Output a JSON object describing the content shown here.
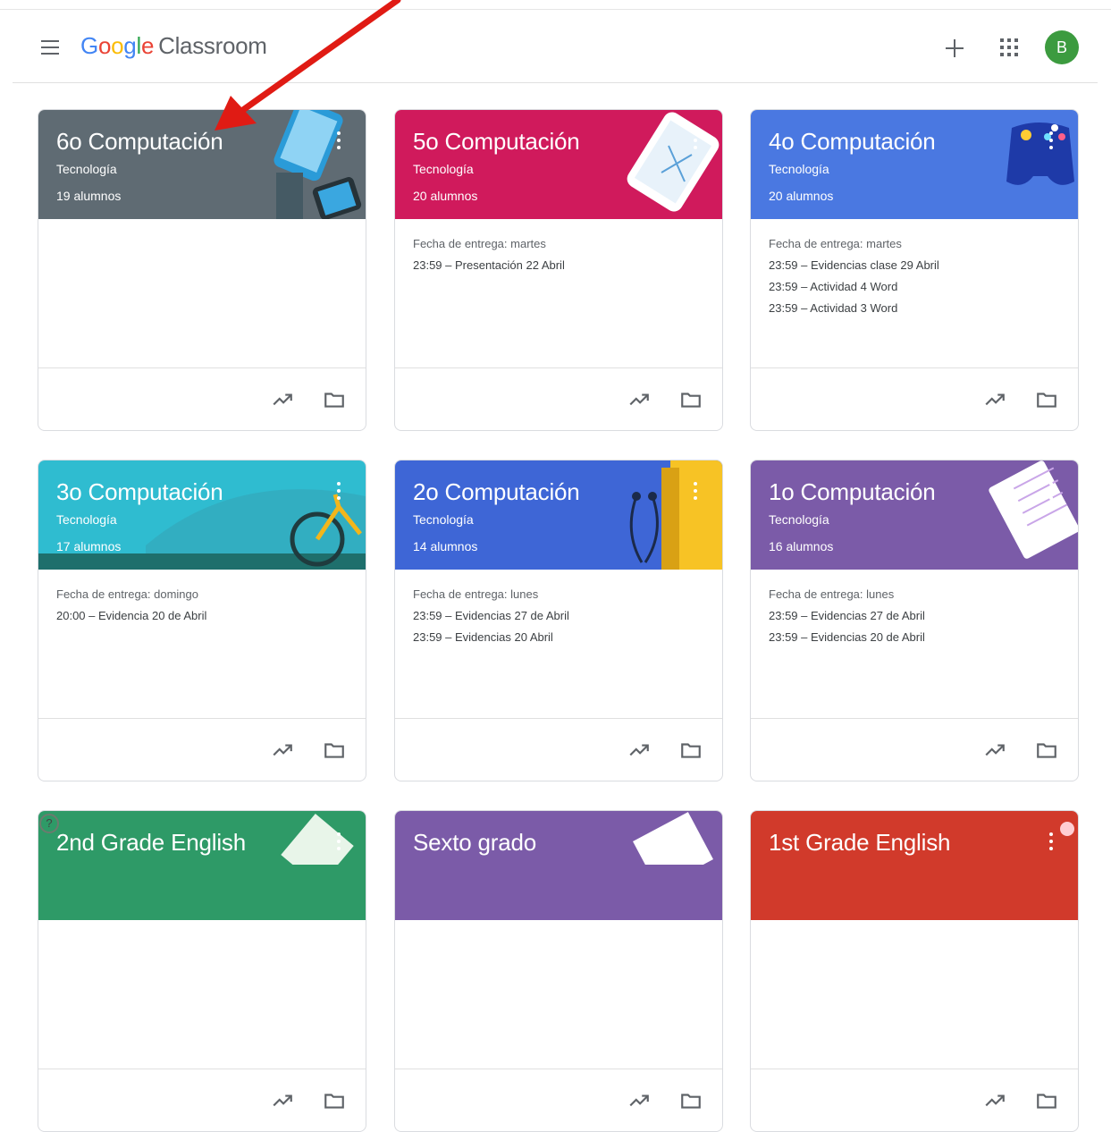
{
  "app": {
    "logo": "Google",
    "name": "Classroom",
    "avatar_initial": "B"
  },
  "colors": {
    "logo_letters": [
      "#4285f4",
      "#ea4335",
      "#fbbc05",
      "#4285f4",
      "#34a853",
      "#ea4335"
    ]
  },
  "icons": {
    "menu": "menu-icon",
    "add": "plus-icon",
    "apps": "apps-grid-icon",
    "stats": "trending-up-icon",
    "folder": "folder-icon",
    "more": "more-vert-icon"
  },
  "cards": [
    {
      "title": "6o Computación",
      "section": "Tecnología",
      "students": "19 alumnos",
      "color": "#5f6b73",
      "due": "",
      "assignments": []
    },
    {
      "title": "5o Computación",
      "section": "Tecnología",
      "students": "20 alumnos",
      "color": "#d01a5c",
      "due": "Fecha de entrega: martes",
      "assignments": [
        "23:59 – Presentación 22 Abril"
      ]
    },
    {
      "title": "4o Computación",
      "section": "Tecnología",
      "students": "20 alumnos",
      "color": "#4a78e1",
      "due": "Fecha de entrega: martes",
      "assignments": [
        "23:59 – Evidencias clase 29 Abril",
        "23:59 – Actividad 4 Word",
        "23:59 – Actividad 3 Word"
      ]
    },
    {
      "title": "3o Computación",
      "section": "Tecnología",
      "students": "17 alumnos",
      "color": "#2fbcd0",
      "due": "Fecha de entrega: domingo",
      "assignments": [
        "20:00 – Evidencia 20 de Abril"
      ]
    },
    {
      "title": "2o Computación",
      "section": "Tecnología",
      "students": "14 alumnos",
      "color": "#3e66d6",
      "due": "Fecha de entrega: lunes",
      "assignments": [
        "23:59 – Evidencias 27 de Abril",
        "23:59 – Evidencias 20 Abril"
      ]
    },
    {
      "title": "1o Computación",
      "section": "Tecnología",
      "students": "16 alumnos",
      "color": "#7b5ba8",
      "due": "Fecha de entrega: lunes",
      "assignments": [
        "23:59 – Evidencias 27 de Abril",
        "23:59 – Evidencias 20 de Abril"
      ]
    },
    {
      "title": "2nd Grade English",
      "section": "",
      "students": "",
      "color": "#2e9a67",
      "due": "",
      "assignments": []
    },
    {
      "title": "Sexto grado",
      "section": "",
      "students": "",
      "color": "#7b5ba8",
      "due": "",
      "assignments": []
    },
    {
      "title": "1st Grade English",
      "section": "",
      "students": "",
      "color": "#d13a2b",
      "due": "",
      "assignments": []
    }
  ]
}
